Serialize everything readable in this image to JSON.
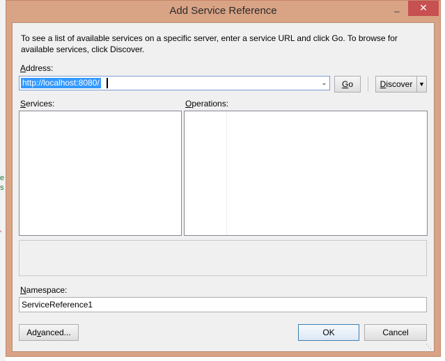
{
  "dialog": {
    "title": "Add Service Reference",
    "minimize_glyph": "_",
    "close_glyph": "✕",
    "intro_text": "To see a list of available services on a specific server, enter a service URL and click Go. To browse for available services, click Discover.",
    "address": {
      "label_accel": "A",
      "label_rest": "ddress:",
      "value": "http://localhost:8080/"
    },
    "go_button": {
      "accel": "G",
      "rest": "o"
    },
    "discover_button": {
      "accel": "D",
      "rest": "iscover"
    },
    "services_label": {
      "accel": "S",
      "rest": "ervices:"
    },
    "operations_label": {
      "accel": "O",
      "rest": "perations:"
    },
    "namespace": {
      "label_accel": "N",
      "label_rest": "amespace:",
      "value": "ServiceReference1"
    },
    "advanced_button": {
      "accel": "v",
      "pre": "Ad",
      "post": "anced..."
    },
    "ok_label": "OK",
    "cancel_label": "Cancel"
  },
  "background_glyphs": {
    "green": "e",
    "green2": "s",
    "red": "'"
  },
  "colors": {
    "window_frame": "#d9a385",
    "close_button": "#c75050",
    "selection": "#3399ff",
    "client_bg": "#f0f0f0"
  },
  "icons": {
    "minimize": "minimize-icon",
    "close": "close-icon",
    "combo_dropdown": "chevron-down-icon",
    "discover_dropdown": "triangle-down-icon",
    "resize_grip": "resize-grip-icon"
  }
}
